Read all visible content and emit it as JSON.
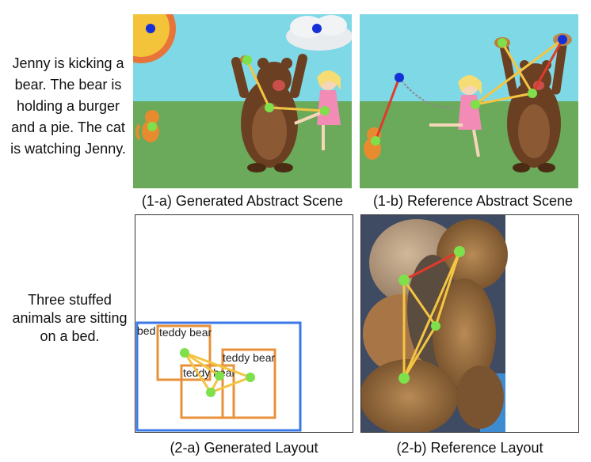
{
  "rows": [
    {
      "description_lines": [
        "Jenny is kicking a",
        "bear. The bear is",
        "holding a burger",
        "and a pie. The cat",
        "is watching Jenny."
      ],
      "panel_a": {
        "caption": "(1-a) Generated Abstract Scene"
      },
      "panel_b": {
        "caption": "(1-b) Reference Abstract Scene"
      }
    },
    {
      "description_lines": [
        "Three stuffed",
        "animals are sitting",
        "on a bed."
      ],
      "panel_a": {
        "caption": "(2-a) Generated Layout",
        "boxes": [
          {
            "label": "bed",
            "color": "#3b78e7"
          },
          {
            "label": "teddy bear",
            "color": "#e8913a"
          },
          {
            "label": "teddy bear",
            "color": "#e8913a"
          },
          {
            "label": "teddy bear",
            "color": "#e8913a"
          }
        ]
      },
      "panel_b": {
        "caption": "(2-b) Reference Layout"
      }
    }
  ],
  "colors": {
    "node": "#7ee04a",
    "node_blue": "#1530d6",
    "edge_yellow": "#f4c542",
    "edge_red": "#e03a2a",
    "sky": "#7fd8e6",
    "grass": "#6aaa5a"
  }
}
